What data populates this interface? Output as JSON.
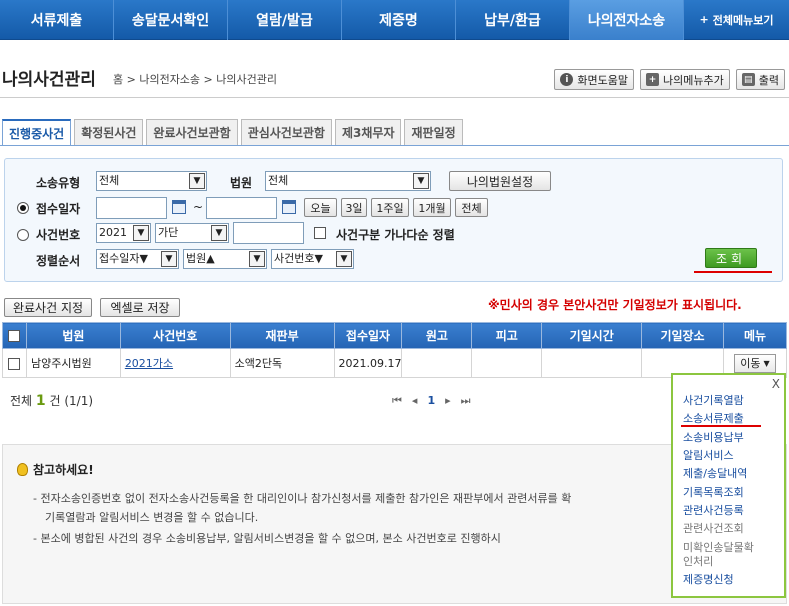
{
  "nav": {
    "items": [
      "서류제출",
      "송달문서확인",
      "열람/발급",
      "제증명",
      "납부/환급",
      "나의전자소송"
    ],
    "all_menu": "전체메뉴보기"
  },
  "page": {
    "title": "나의사건관리",
    "breadcrumb": "홈 > 나의전자소송 > 나의사건관리",
    "help": "화면도움말",
    "add_menu": "나의메뉴추가",
    "print": "출력"
  },
  "tabs": [
    "진행중사건",
    "확정된사건",
    "완료사건보관함",
    "관심사건보관함",
    "제3채무자",
    "재판일정"
  ],
  "search": {
    "case_type_label": "소송유형",
    "case_type_value": "전체",
    "court_label": "법원",
    "court_value": "전체",
    "my_court_btn": "나의법원설정",
    "date_label": "접수일자",
    "tilde": "~",
    "period_btns": [
      "오늘",
      "3일",
      "1주일",
      "1개월",
      "전체"
    ],
    "caseno_label": "사건번호",
    "year_value": "2021",
    "case_code_value": "가단",
    "sort_chk_label": "사건구분 가나다순 정렬",
    "sort_label": "정렬순서",
    "sort1": "접수일자▼",
    "sort2": "법원▲",
    "sort3": "사건번호▼",
    "search_btn": "조회"
  },
  "actions": {
    "complete_btn": "완료사건 지정",
    "excel_btn": "엑셀로 저장",
    "notice": "※민사의 경우 본안사건만 기일정보가 표시됩니다."
  },
  "table": {
    "headers": [
      "법원",
      "사건번호",
      "재판부",
      "접수일자",
      "원고",
      "피고",
      "기일시간",
      "기일장소",
      "메뉴"
    ],
    "rows": [
      {
        "court": "남양주시법원",
        "case_no": "2021가소",
        "division": "소액2단독",
        "date": "2021.09.17",
        "move": "이동"
      }
    ]
  },
  "pager": {
    "total_prefix": "전체",
    "total_count": "1",
    "total_suffix": "건 (1/1)",
    "current_page": "1"
  },
  "info": {
    "title": "참고하세요!",
    "lines": [
      "- 전자소송인증번호 없이 전자소송사건등록을 한 대리인이나 참가신청서를 제출한 참가인은 재판부에서 관련서류를 확",
      "기록열람과 알림서비스 변경을 할 수 없습니다.",
      "- 본소에 병합된 사건의 경우 소송비용납부, 알림서비스변경을 할 수 없으며, 본소 사건번호로 진행하시"
    ]
  },
  "menu": {
    "close": "X",
    "items": [
      "사건기록열람",
      "소송서류제출",
      "소송비용납부",
      "알림서비스",
      "제출/송달내역",
      "기록목록조회",
      "관련사건등록",
      "관련사건조회",
      "미확인송달물확",
      "인처리",
      "제증명신청"
    ]
  }
}
